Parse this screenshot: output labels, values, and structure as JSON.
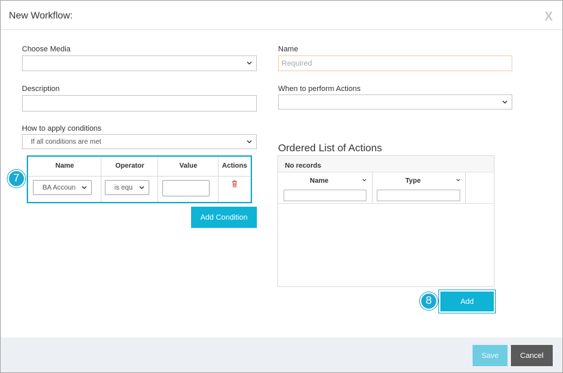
{
  "dialog": {
    "title": "New Workflow:",
    "close_label": "X"
  },
  "form": {
    "choose_media": {
      "label": "Choose Media",
      "value": ""
    },
    "name": {
      "label": "Name",
      "placeholder": "Required",
      "value": ""
    },
    "description": {
      "label": "Description",
      "value": ""
    },
    "when_to_perform": {
      "label": "When to perform Actions",
      "value": ""
    },
    "how_to_apply": {
      "label": "How to apply conditions",
      "value": "If all conditions are met"
    }
  },
  "conditions": {
    "badge": "7",
    "columns": [
      "Name",
      "Operator",
      "Value",
      "Actions"
    ],
    "rows": [
      {
        "name": "BA Accoun",
        "operator": "is equ",
        "value": ""
      }
    ],
    "add_button": "Add Condition"
  },
  "actions": {
    "title": "Ordered List of Actions",
    "no_records": "No records",
    "columns": [
      "Name",
      "Type"
    ],
    "badge": "8",
    "add_button": "Add"
  },
  "footer": {
    "save_label": "Save",
    "cancel_label": "Cancel"
  },
  "colors": {
    "accent": "#0fb3d6",
    "badge": "#1ba9d4",
    "cancel": "#5a5a5a",
    "save_disabled": "#6fcde3",
    "delete_icon": "#d9534f"
  }
}
